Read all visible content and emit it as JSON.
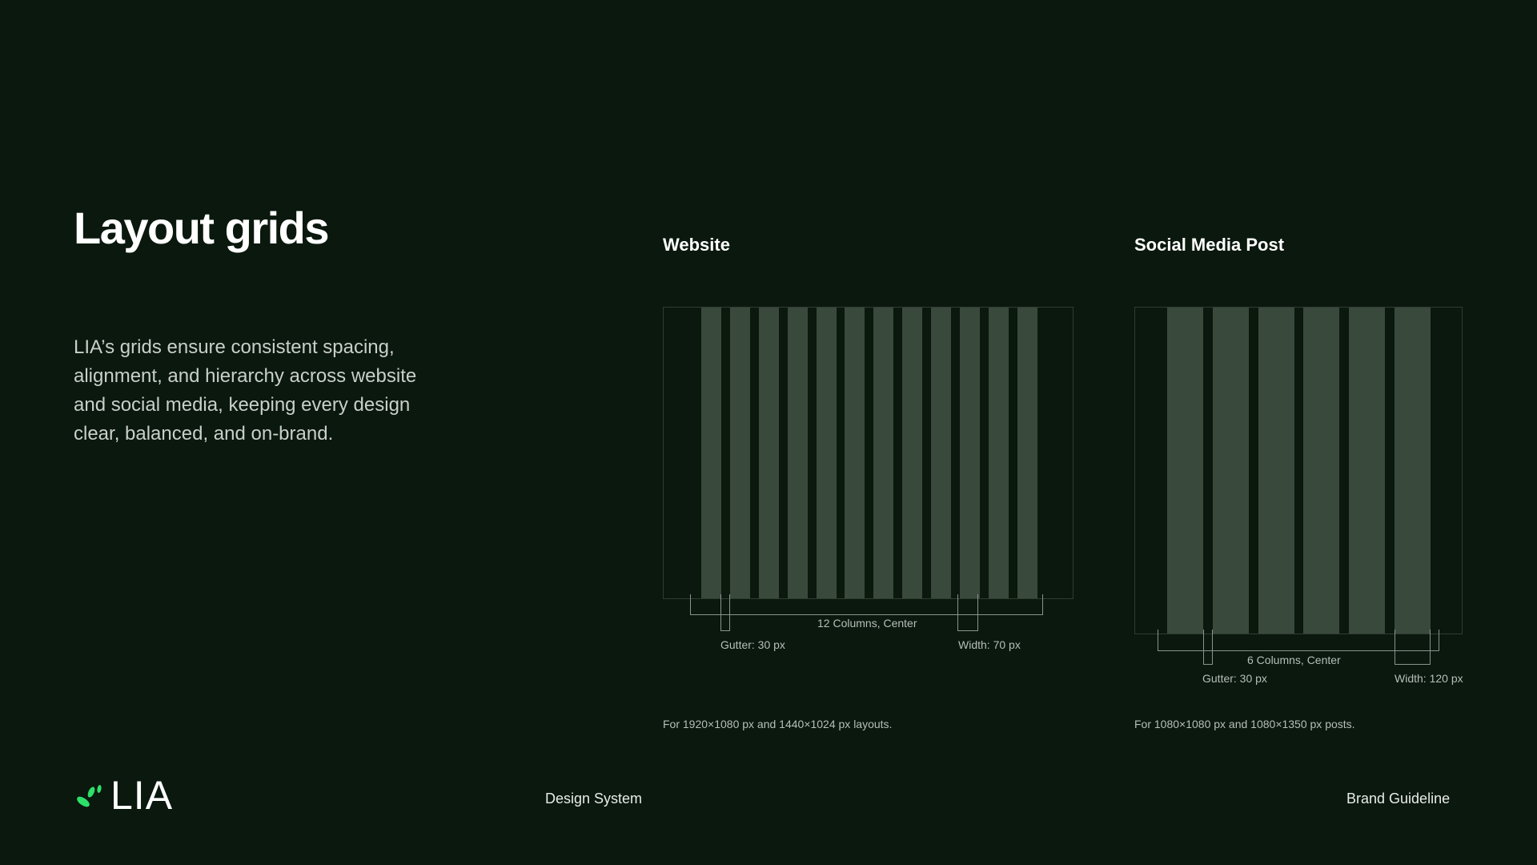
{
  "page": {
    "title": "Layout grids",
    "description": "LIA’s grids ensure consistent spacing, alignment, and hierarchy across website and social media, keeping every design clear, balanced, and on-brand."
  },
  "website": {
    "heading": "Website",
    "columns_label": "12 Columns, Center",
    "gutter_label": "Gutter: 30 px",
    "width_label": "Width: 70 px",
    "note": "For 1920×1080 px and 1440×1024 px layouts.",
    "column_count": 12
  },
  "social": {
    "heading": "Social Media Post",
    "columns_label": "6 Columns, Center",
    "gutter_label": "Gutter: 30 px",
    "width_label": "Width: 120 px",
    "note": "For 1080×1080 px and 1080×1350 px posts.",
    "column_count": 6
  },
  "footer": {
    "logo_text": "LIA",
    "center_label": "Design System",
    "right_label": "Brand Guideline"
  },
  "colors": {
    "background": "#0a180e",
    "grid_column": "#394a3c",
    "logo_accent": "#2ee06a"
  }
}
